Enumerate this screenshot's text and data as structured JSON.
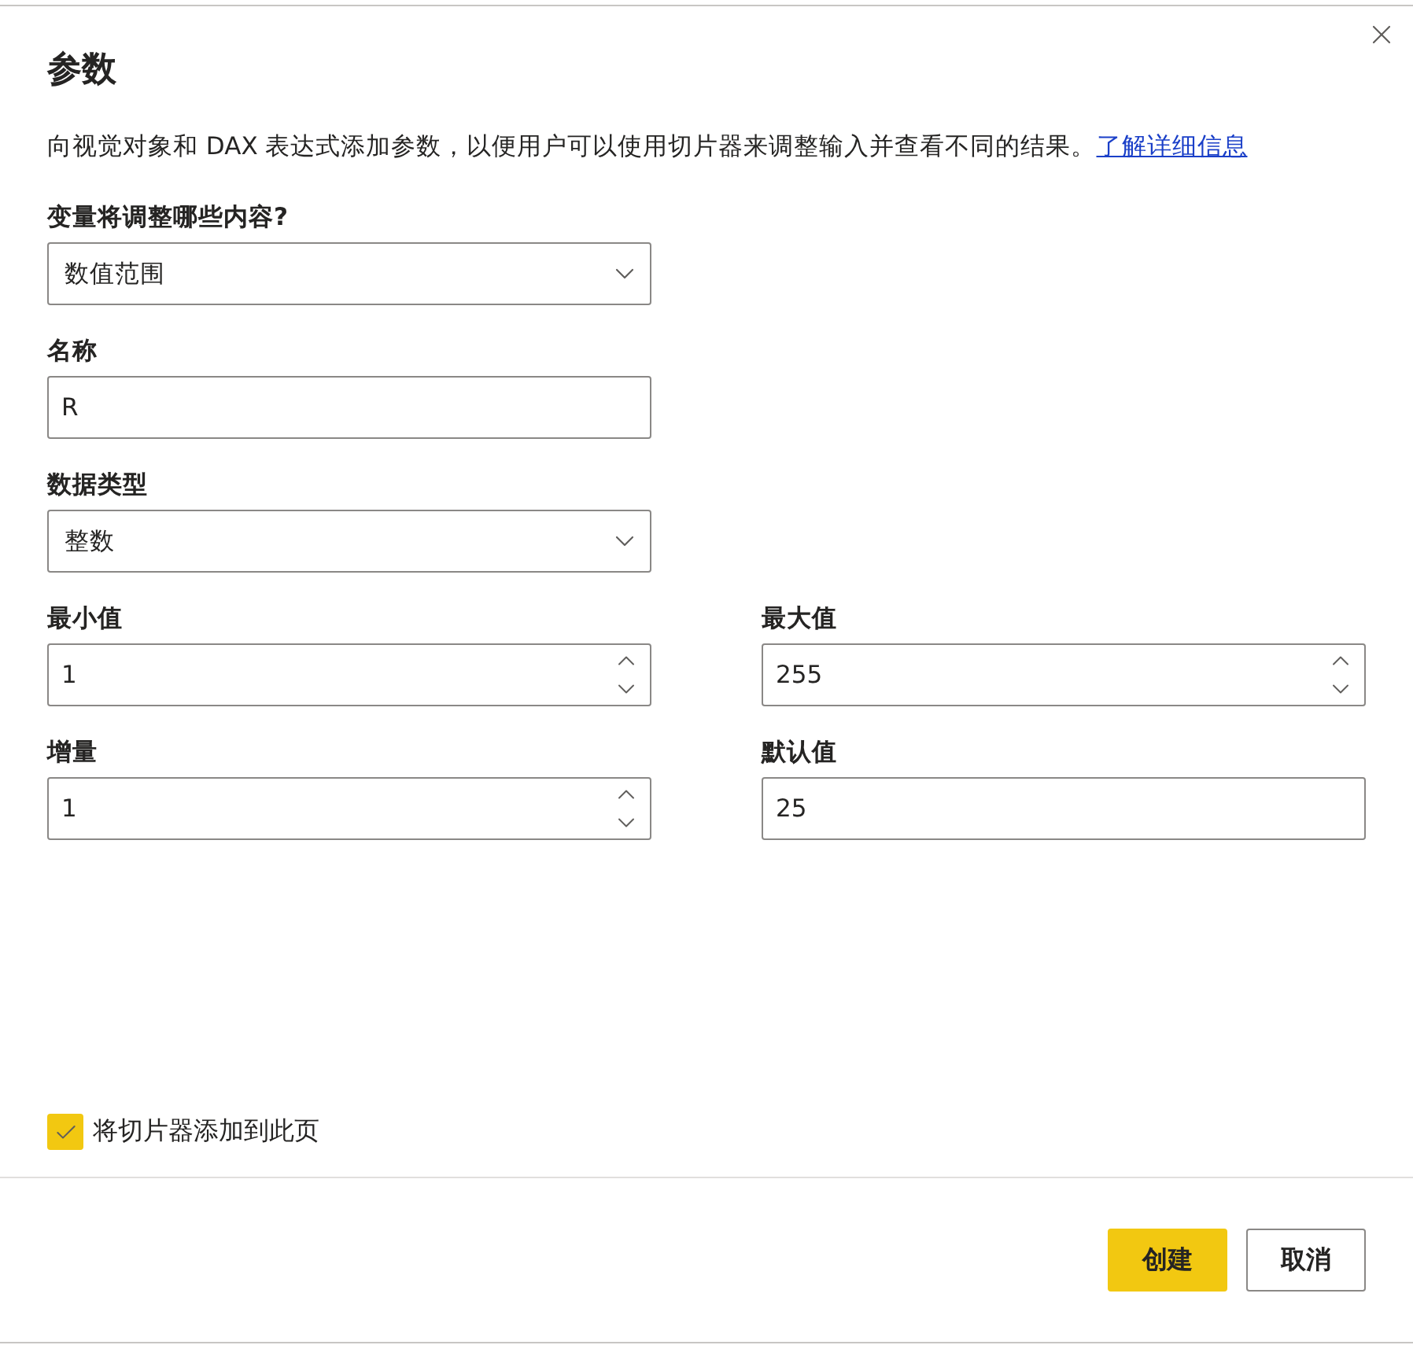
{
  "title": "参数",
  "description": {
    "text": "向视觉对象和 DAX 表达式添加参数，以便用户可以使用切片器来调整输入并查看不同的结果。",
    "link": "了解详细信息"
  },
  "fields": [
    {
      "label": "变量将调整哪些内容?",
      "kind": "select",
      "value": "数值范围"
    },
    {
      "label": "名称",
      "kind": "text",
      "value": "R"
    },
    {
      "label": "数据类型",
      "kind": "select",
      "value": "整数"
    }
  ],
  "grid_fields": [
    {
      "label": "最小值",
      "kind": "number",
      "value": "1"
    },
    {
      "label": "最大值",
      "kind": "number",
      "value": "255"
    },
    {
      "label": "增量",
      "kind": "number",
      "value": "1"
    },
    {
      "label": "默认值",
      "kind": "text",
      "value": "25"
    }
  ],
  "checkbox": {
    "label": "将切片器添加到此页",
    "checked": true
  },
  "buttons": [
    {
      "label": "创建",
      "kind": "primary"
    },
    {
      "label": "取消",
      "kind": "secondary"
    }
  ]
}
